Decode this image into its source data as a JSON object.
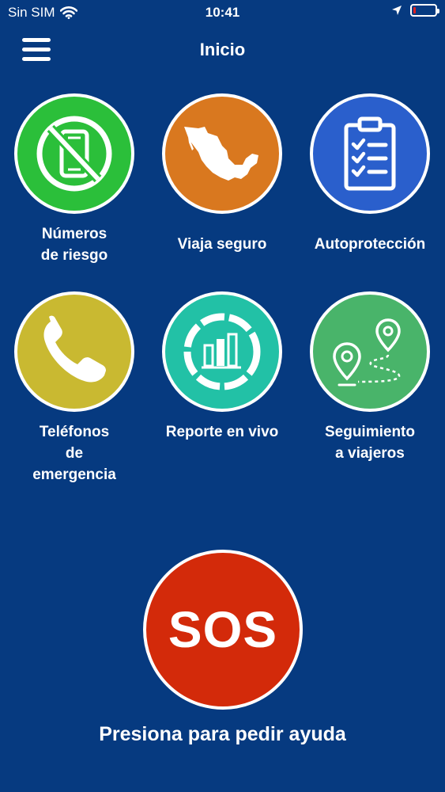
{
  "status_bar": {
    "carrier": "Sin SIM",
    "time": "10:41",
    "battery_level": 0.1
  },
  "header": {
    "title": "Inicio",
    "menu_icon": "hamburger-icon"
  },
  "tiles": [
    {
      "label": "Números\nde riesgo",
      "icon": "no-phone-icon",
      "color": "#2bbf3a"
    },
    {
      "label": "Viaja seguro",
      "icon": "mexico-map-icon",
      "color": "#d9781f"
    },
    {
      "label": "Autoprotección",
      "icon": "clipboard-checklist-icon",
      "color": "#2a5fcc"
    },
    {
      "label": "Teléfonos\nde\nemergencia",
      "icon": "phone-icon",
      "color": "#c9b931"
    },
    {
      "label": "Reporte en vivo",
      "icon": "live-report-chart-icon",
      "color": "#22c1a6"
    },
    {
      "label": "Seguimiento\na viajeros",
      "icon": "route-pins-icon",
      "color": "#49b46a"
    }
  ],
  "sos": {
    "label": "SOS",
    "caption": "Presiona para pedir ayuda",
    "color": "#d32a0a"
  }
}
